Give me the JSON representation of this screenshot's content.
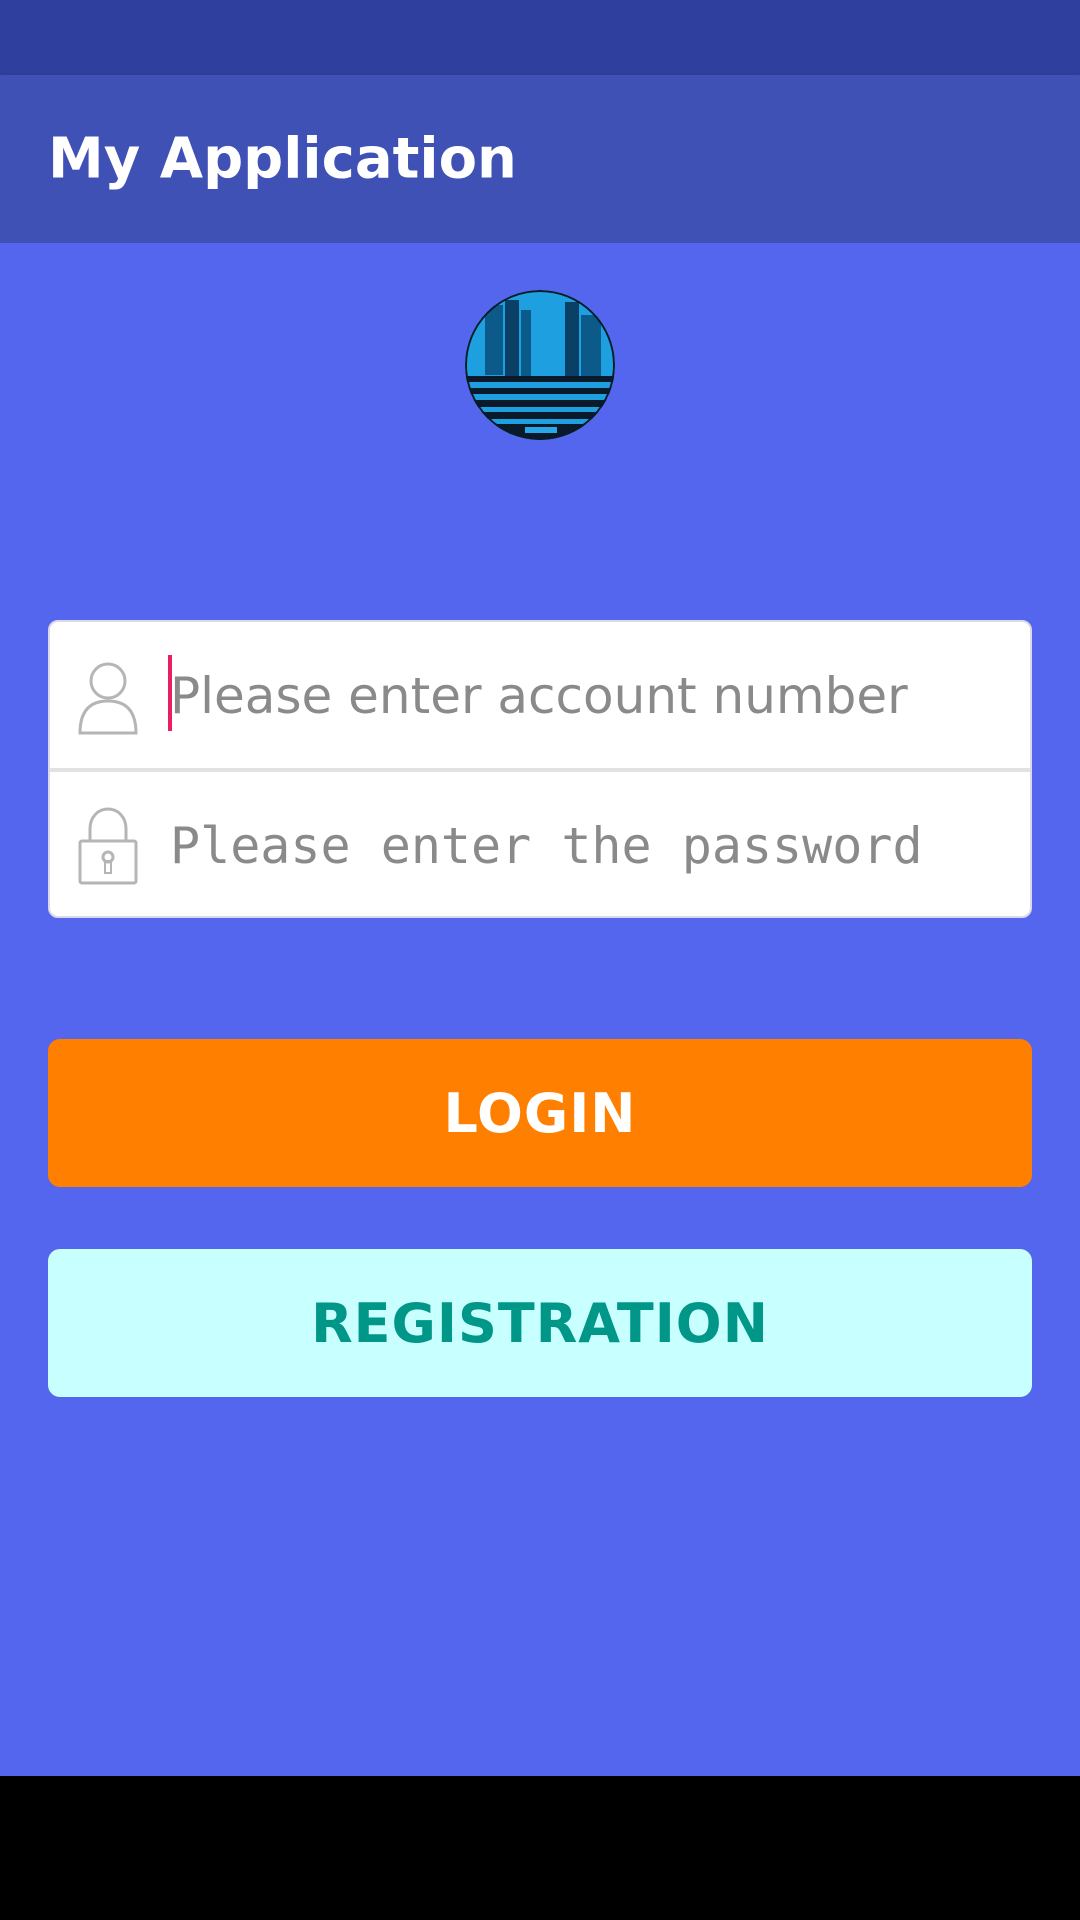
{
  "app_bar": {
    "title": "My Application"
  },
  "logo": {
    "icon": "app-logo-image"
  },
  "form": {
    "account": {
      "icon": "user-icon",
      "placeholder": "Please enter account number",
      "value": ""
    },
    "password": {
      "icon": "lock-icon",
      "placeholder": "Please enter the password",
      "value": ""
    }
  },
  "buttons": {
    "login_label": "LOGIN",
    "register_label": "REGISTRATION"
  },
  "colors": {
    "background": "#5566ee",
    "app_bar": "#3f51b5",
    "status_bar": "#2f3f9d",
    "login": "#ff7f00",
    "register_bg": "#c8ffff",
    "register_text": "#009688",
    "caret": "#e91e63"
  }
}
